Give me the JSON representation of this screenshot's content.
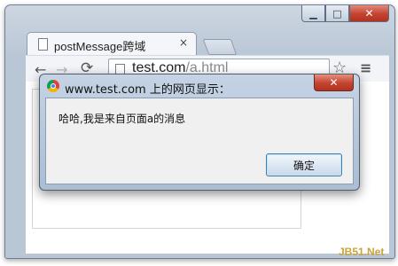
{
  "browser": {
    "window_controls": {
      "minimize": "▁",
      "maximize": "□",
      "close": "✕"
    },
    "tab": {
      "title": "postMessage跨域",
      "close": "×"
    },
    "toolbar": {
      "url_host": "test.com",
      "url_path": "/a.html",
      "back": "←",
      "forward": "→",
      "reload": "⟳",
      "star": "☆",
      "menu": "≡"
    }
  },
  "dialog": {
    "title": "www.test.com 上的网页显示：",
    "close": "✕",
    "message": "哈哈,我是来自页面a的消息",
    "ok_label": "确定"
  },
  "watermark": "JB51.Net"
}
